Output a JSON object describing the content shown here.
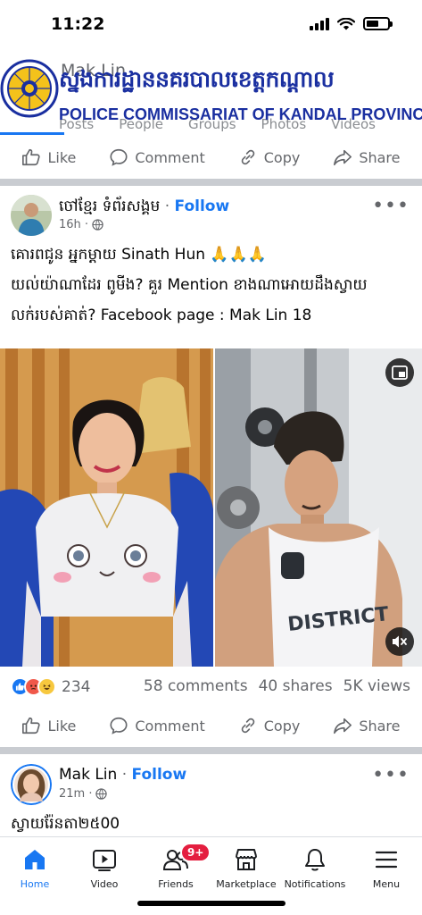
{
  "status_bar": {
    "time": "11:22"
  },
  "profile_header": {
    "name": "Mak Lin",
    "tabs": [
      "Posts",
      "People",
      "Groups",
      "Photos",
      "Videos"
    ],
    "watermark_kh": "ស្នងការដ្ឋាននគរបាលខេត្តកណ្តាល",
    "watermark_en": "POLICE COMMISSARIAT OF KANDAL PROVINCE"
  },
  "actions": {
    "like": "Like",
    "comment": "Comment",
    "copy": "Copy",
    "share": "Share"
  },
  "post1": {
    "author": "ចៅខ្មែរ ទំព័រសង្គម",
    "dot": "·",
    "follow": "Follow",
    "time": "16h ·",
    "lines": [
      "គោរពជូន អ្នកម្តាយ Sinath Hun 🙏🙏🙏",
      "យល់យ៉ាណាដែរ ពូមីង? គួរ Mention ខាងណាអោយដឹងស្វាយ",
      "លក់របស់គាត់? Facebook page : Mak Lin 18"
    ],
    "reaction_count": "234",
    "comments": "58 comments",
    "shares": "40 shares",
    "views": "5K views"
  },
  "post2": {
    "author": "Mak Lin",
    "dot": "·",
    "follow": "Follow",
    "time": "21m ·",
    "text": "ស្វាយរ៉ែនតា២៥00"
  },
  "tabbar": {
    "items": [
      "Home",
      "Video",
      "Friends",
      "Marketplace",
      "Notifications",
      "Menu"
    ],
    "friends_badge": "9+"
  },
  "colors": {
    "accent": "#1877f2",
    "badge": "#e41e3f",
    "watermark": "#1a2fa0"
  }
}
